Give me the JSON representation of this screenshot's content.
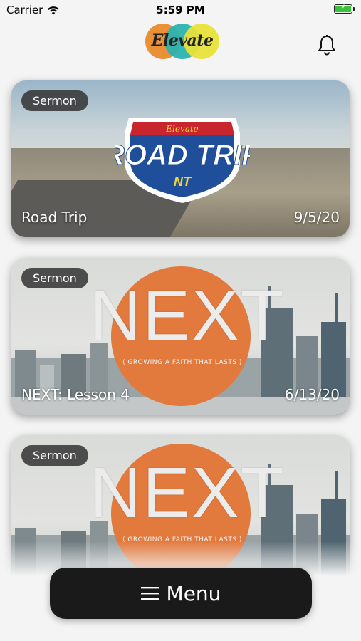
{
  "status": {
    "carrier": "Carrier",
    "time": "5:59 PM"
  },
  "header": {
    "logo_text": "Elevate",
    "logo_colors": [
      "#e98a2c",
      "#2bb3b0",
      "#e9e13a"
    ]
  },
  "cards": [
    {
      "badge": "Sermon",
      "title": "Road Trip",
      "date": "9/5/20",
      "art": {
        "top": "Elevate",
        "main": "ROAD TRIP",
        "bottom": "NT"
      }
    },
    {
      "badge": "Sermon",
      "title": "NEXT: Lesson 4",
      "date": "6/13/20",
      "art": {
        "main": "NEXT",
        "sub": "( GROWING A FAITH THAT LASTS )"
      }
    },
    {
      "badge": "Sermon",
      "title": "",
      "date": "",
      "art": {
        "main": "NEXT",
        "sub": "( GROWING A FAITH THAT LASTS )"
      }
    }
  ],
  "menu": {
    "label": "Menu"
  }
}
